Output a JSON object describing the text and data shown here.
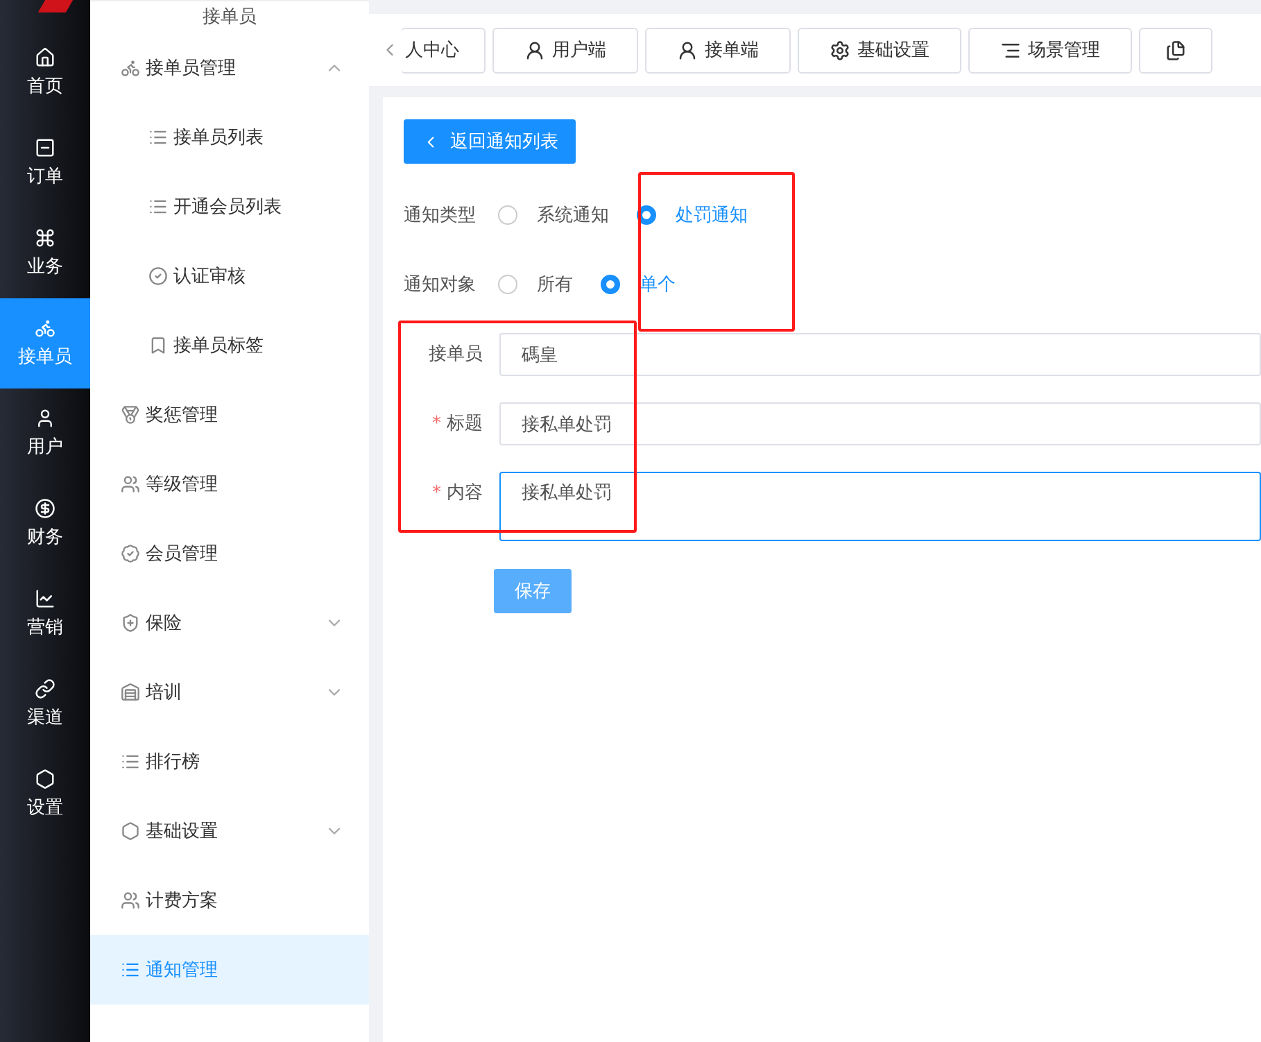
{
  "main_nav": [
    {
      "label": "首页",
      "selected": false
    },
    {
      "label": "订单",
      "selected": false
    },
    {
      "label": "业务",
      "selected": false
    },
    {
      "label": "接单员",
      "selected": true
    },
    {
      "label": "用户",
      "selected": false
    },
    {
      "label": "财务",
      "selected": false
    },
    {
      "label": "营销",
      "selected": false
    },
    {
      "label": "渠道",
      "selected": false
    },
    {
      "label": "设置",
      "selected": false
    }
  ],
  "sub_nav": {
    "title": "接单员",
    "items": [
      {
        "label": "接单员管理",
        "expanded": true,
        "selected": false,
        "children": [
          {
            "label": "接单员列表",
            "selected": false
          },
          {
            "label": "开通会员列表",
            "selected": false
          },
          {
            "label": "认证审核",
            "selected": false
          },
          {
            "label": "接单员标签",
            "selected": false
          }
        ]
      },
      {
        "label": "奖惩管理",
        "selected": false
      },
      {
        "label": "等级管理",
        "selected": false
      },
      {
        "label": "会员管理",
        "selected": false
      },
      {
        "label": "保险",
        "expanded": false,
        "selected": false
      },
      {
        "label": "培训",
        "expanded": false,
        "selected": false
      },
      {
        "label": "排行榜",
        "selected": false
      },
      {
        "label": "基础设置",
        "expanded": false,
        "selected": false
      },
      {
        "label": "计费方案",
        "selected": false
      },
      {
        "label": "通知管理",
        "selected": true
      }
    ]
  },
  "tabs": [
    {
      "label": "人中心"
    },
    {
      "label": "用户端"
    },
    {
      "label": "接单端"
    },
    {
      "label": "基础设置"
    },
    {
      "label": "场景管理"
    },
    {
      "kind": "icon_only"
    }
  ],
  "back_button": "返回通知列表",
  "radio_rows": [
    {
      "label": "通知类型",
      "options": [
        {
          "label": "系统通知",
          "selected": false
        },
        {
          "label": "处罚通知",
          "selected": true
        }
      ]
    },
    {
      "label": "通知对象",
      "options": [
        {
          "label": "所有",
          "selected": false
        },
        {
          "label": "单个",
          "selected": true
        }
      ]
    }
  ],
  "fields": [
    {
      "label": "接单员",
      "kind": "input",
      "value": "碼皇",
      "focused": false
    },
    {
      "label": "标题",
      "required_mark": "*",
      "kind": "input",
      "value": "接私单处罚",
      "focused": false
    },
    {
      "label": "内容",
      "required_mark": "*",
      "kind": "textarea",
      "value": "接私单处罚",
      "focused": true
    }
  ],
  "save_button": "保存",
  "annotations": [
    {
      "kind": "frame",
      "color": "#ff1a1a"
    },
    {
      "kind": "frame",
      "color": "#ff1a1a"
    }
  ]
}
